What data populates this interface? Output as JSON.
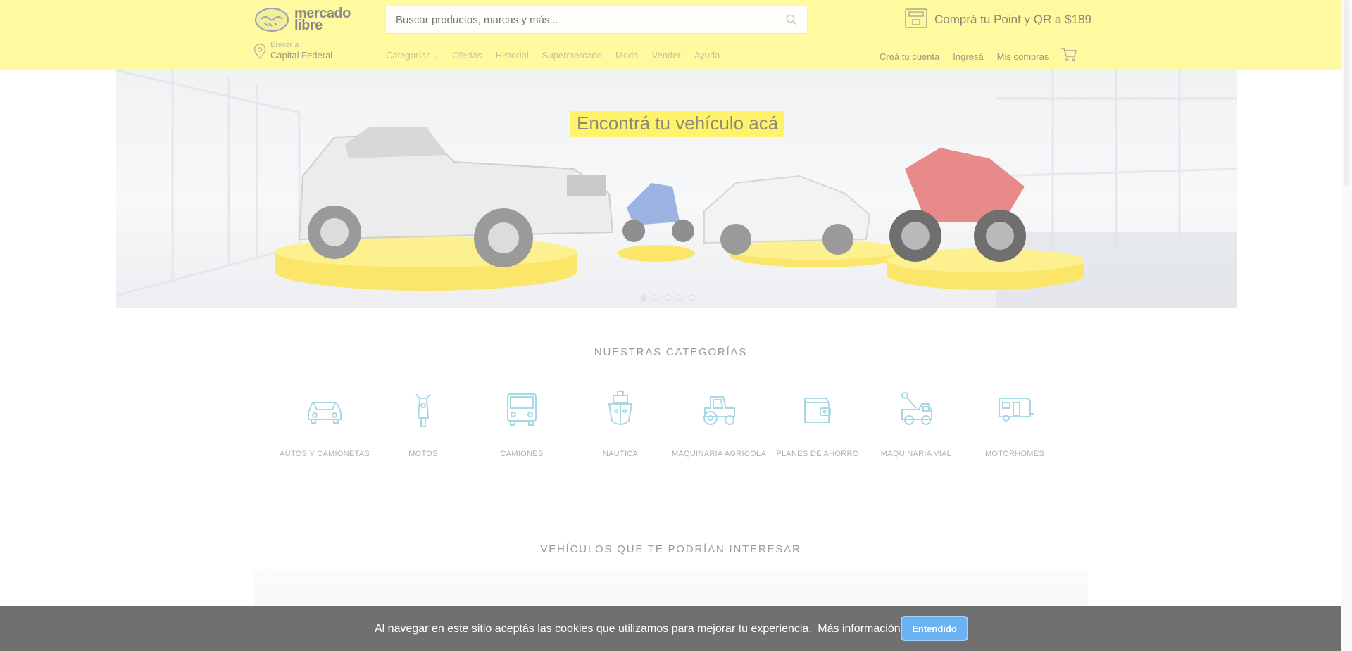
{
  "header": {
    "logo_text": "mercado\nlibre",
    "search_placeholder": "Buscar productos, marcas y más...",
    "promo": "Comprá tu Point y QR a $189",
    "location": {
      "label": "Enviar a",
      "value": "Capital Federal"
    },
    "nav": [
      {
        "label": "Categorías"
      },
      {
        "label": "Ofertas"
      },
      {
        "label": "Historial"
      },
      {
        "label": "Supermercado"
      },
      {
        "label": "Moda"
      },
      {
        "label": "Vender"
      },
      {
        "label": "Ayuda"
      }
    ],
    "user_nav": [
      {
        "label": "Creá tu cuenta"
      },
      {
        "label": "Ingresá"
      },
      {
        "label": "Mis compras"
      }
    ]
  },
  "hero": {
    "title": "Encontrá tu vehículo acá",
    "slides": 5,
    "active_slide": 1
  },
  "categories": {
    "title": "NUESTRAS CATEGORÍAS",
    "items": [
      {
        "label": "AUTOS Y CAMIONETAS",
        "icon": "car-icon"
      },
      {
        "label": "MOTOS",
        "icon": "motorcycle-icon"
      },
      {
        "label": "CAMIONES",
        "icon": "truck-icon"
      },
      {
        "label": "NAUTICA",
        "icon": "boat-icon"
      },
      {
        "label": "MAQUINARIA AGRICOLA",
        "icon": "tractor-icon"
      },
      {
        "label": "PLANES DE AHORRO",
        "icon": "wallet-icon"
      },
      {
        "label": "MAQUINARIA VIAL",
        "icon": "tow-truck-icon"
      },
      {
        "label": "MOTORHOMES",
        "icon": "caravan-icon"
      }
    ]
  },
  "vehicles": {
    "title": "VEHÍCULOS QUE TE PODRÍAN INTERESAR"
  },
  "cookie": {
    "text": "Al navegar en este sitio aceptás las cookies que utilizamos para mejorar tu experiencia.",
    "link": "Más información.",
    "button": "Entendido"
  },
  "colors": {
    "header_bg": "#fff9a0",
    "hero_title_bg": "#fff36b",
    "category_icon": "#a7d8e3",
    "cookie_bg": "#707070",
    "cookie_button": "#69b3f2"
  }
}
